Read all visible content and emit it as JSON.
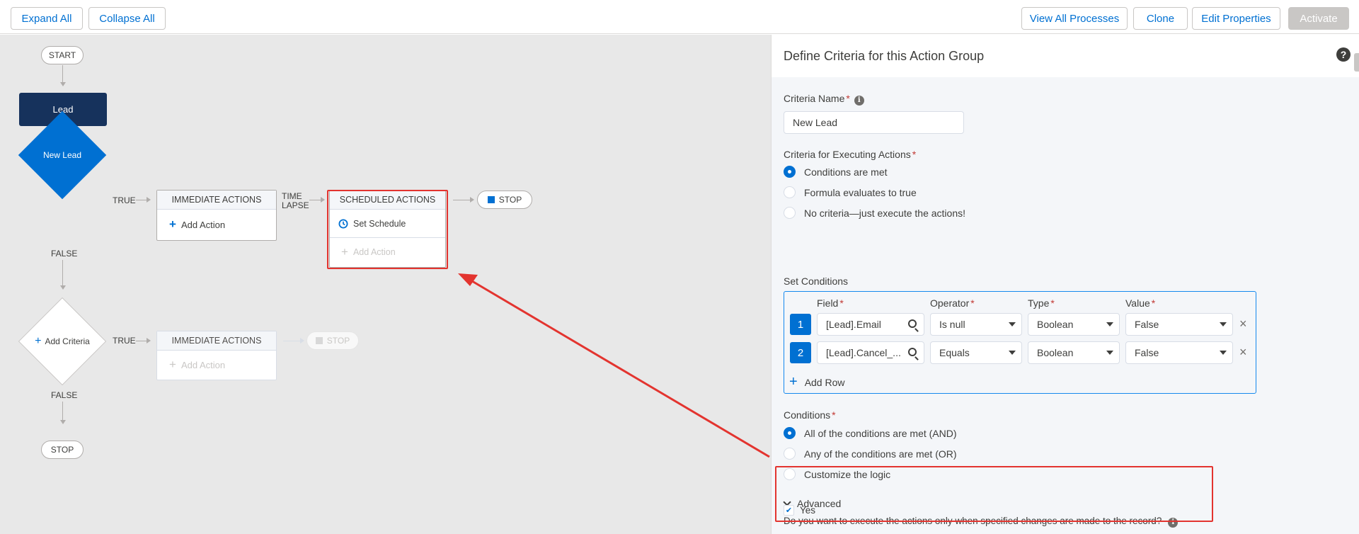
{
  "toolbar": {
    "expand_all": "Expand All",
    "collapse_all": "Collapse All",
    "view_all_processes": "View All Processes",
    "clone": "Clone",
    "edit_properties": "Edit Properties",
    "activate": "Activate"
  },
  "canvas": {
    "start": "START",
    "object_node": "Lead",
    "criteria_1": "New Lead",
    "criteria_2": "Add Criteria",
    "true_label": "TRUE",
    "false_label": "FALSE",
    "time_lapse": "TIME LAPSE",
    "immediate_actions": "IMMEDIATE ACTIONS",
    "scheduled_actions": "SCHEDULED ACTIONS",
    "add_action": "Add Action",
    "set_schedule": "Set Schedule",
    "stop": "STOP"
  },
  "panel": {
    "title": "Define Criteria for this Action Group",
    "help_icon": "help-icon",
    "criteria_name_label": "Criteria Name",
    "criteria_name_value": "New Lead",
    "executing_label": "Criteria for Executing Actions",
    "executing_options": [
      {
        "label": "Conditions are met",
        "selected": true
      },
      {
        "label": "Formula evaluates to true",
        "selected": false
      },
      {
        "label": "No criteria—just execute the actions!",
        "selected": false
      }
    ],
    "set_conditions_label": "Set Conditions",
    "columns": {
      "field": "Field",
      "operator": "Operator",
      "type": "Type",
      "value": "Value"
    },
    "rows": [
      {
        "num": "1",
        "field": "[Lead].Email",
        "operator": "Is null",
        "type": "Boolean",
        "value": "False"
      },
      {
        "num": "2",
        "field": "[Lead].Cancel_...",
        "operator": "Equals",
        "type": "Boolean",
        "value": "False"
      }
    ],
    "add_row": "Add Row",
    "conditions_label": "Conditions",
    "conditions_options": [
      {
        "label": "All of the conditions are met (AND)",
        "selected": true
      },
      {
        "label": "Any of the conditions are met (OR)",
        "selected": false
      },
      {
        "label": "Customize the logic",
        "selected": false
      }
    ],
    "advanced_label": "Advanced",
    "advanced_question": "Do you want to execute the actions only when specified changes are made to the record?",
    "yes_label": "Yes",
    "yes_checked": true
  },
  "colors": {
    "brand_blue": "#0070d2",
    "navy": "#16325c",
    "annotation_red": "#e3342f"
  }
}
